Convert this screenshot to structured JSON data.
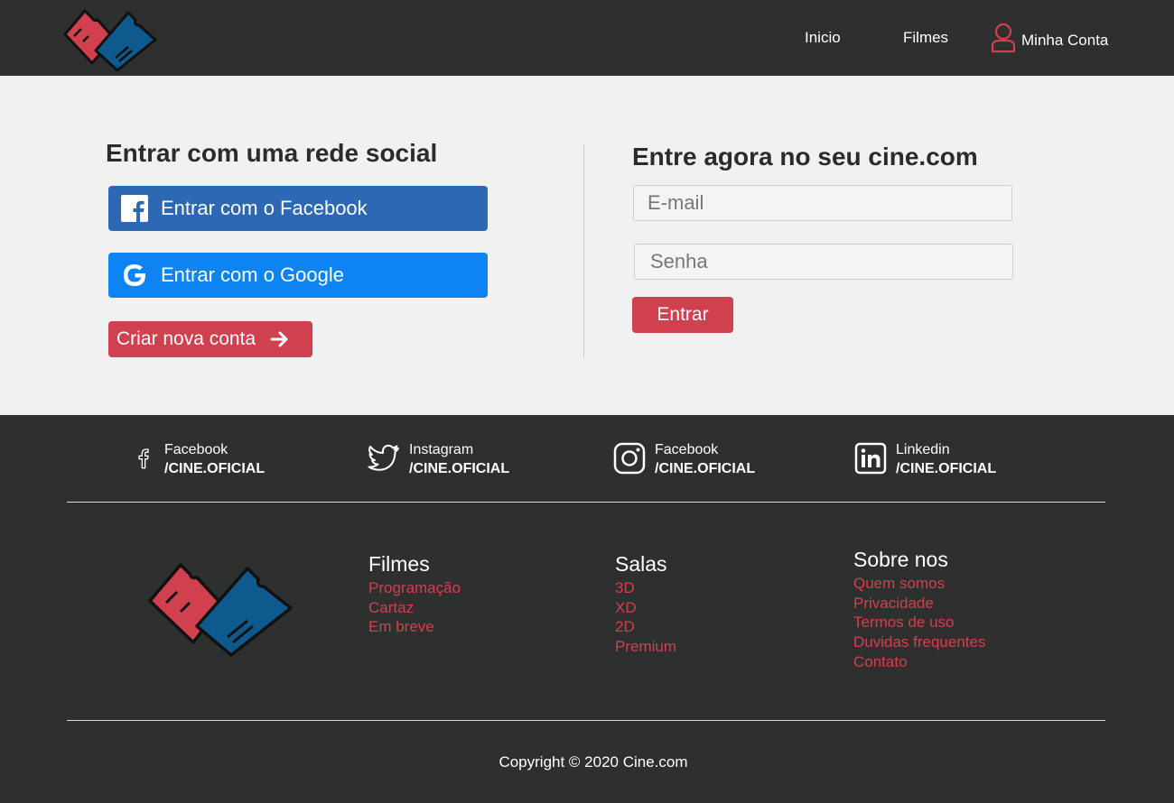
{
  "header": {
    "logo_icon": "tickets-heart-logo",
    "nav": [
      {
        "label": "Inicio"
      },
      {
        "label": "Filmes"
      }
    ],
    "account": {
      "label": "Minha Conta",
      "icon": "user-icon"
    }
  },
  "social_login": {
    "title": "Entrar com uma rede social",
    "facebook_label": "Entrar com o Facebook",
    "google_label": "Entrar com o Google",
    "create_account_label": "Criar nova conta"
  },
  "login": {
    "title": "Entre agora no seu cine.com",
    "email_placeholder": "E-mail",
    "password_placeholder": "Senha",
    "submit_label": "Entrar"
  },
  "footer": {
    "social": [
      {
        "name": "Facebook",
        "handle": "/CINE.OFICIAL",
        "icon": "facebook-icon"
      },
      {
        "name": "Instagram",
        "handle": "/CINE.OFICIAL",
        "icon": "twitter-icon"
      },
      {
        "name": "Facebook",
        "handle": "/CINE.OFICIAL",
        "icon": "instagram-icon"
      },
      {
        "name": "Linkedin",
        "handle": "/CINE.OFICIAL",
        "icon": "linkedin-icon"
      }
    ],
    "columns": {
      "filmes": {
        "title": "Filmes",
        "links": [
          "Programação",
          "Cartaz",
          "Em breve"
        ]
      },
      "salas": {
        "title": "Salas",
        "links": [
          "3D",
          "XD",
          "2D",
          "Premium"
        ]
      },
      "sobre": {
        "title": "Sobre nos",
        "links": [
          "Quem somos",
          "Privacidade",
          "Termos de uso",
          "Duvidas frequentes",
          "Contato"
        ]
      }
    },
    "copyright": "Copyright © 2020 Cine.com"
  },
  "colors": {
    "dark_bg": "#2e2f2f",
    "accent_red": "#d1404e",
    "facebook_blue": "#2c68b4",
    "google_blue": "#0d84f2",
    "ticket_blue": "#0e5a8f"
  }
}
